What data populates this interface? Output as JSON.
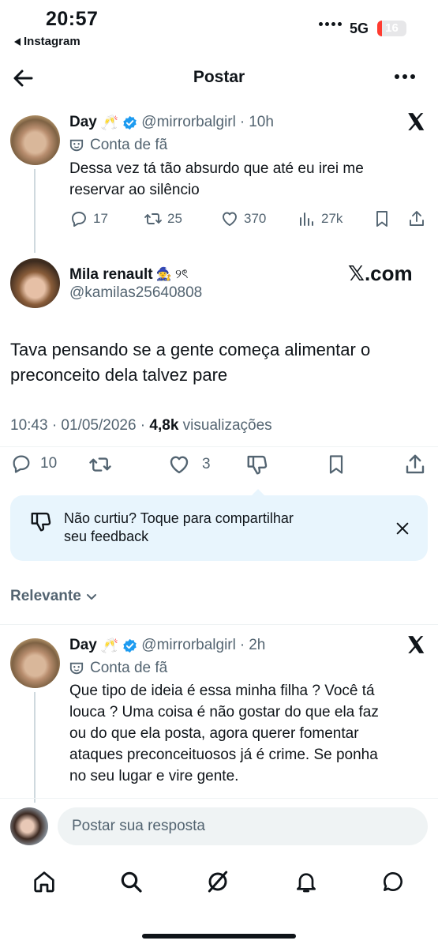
{
  "status_bar": {
    "time": "20:57",
    "back_app": "Instagram",
    "network": "5G",
    "battery": "16"
  },
  "header": {
    "title": "Postar"
  },
  "parent_post": {
    "name": "Day",
    "emoji": "🥂",
    "handle": "@mirrorbalgirl",
    "time": "10h",
    "badge": "Conta de fã",
    "text_lines": [
      "Dessa vez tá tão absurdo que até eu irei me",
      "reservar ao silêncio"
    ],
    "replies": "17",
    "reposts": "25",
    "likes": "370",
    "views": "27k"
  },
  "main_post": {
    "name": "Mila renault",
    "name_emoji": "🧙‍♀️ ୨ৎ",
    "handle": "@kamilas25640808",
    "watermark": "𝕏.com",
    "text_lines": [
      "Tava pensando se a gente começa alimentar o",
      "preconceito dela talvez pare"
    ],
    "timestamp": "10:43 · 01/05/2026 · ",
    "views_count": "4,8k",
    "views_label": " visualizações",
    "replies": "10",
    "likes": "3"
  },
  "feedback_banner": {
    "lines": [
      "Não curtiu? Toque para compartilhar",
      "seu feedback"
    ]
  },
  "sort": {
    "label": "Relevante"
  },
  "reply_post": {
    "name": "Day",
    "emoji": "🥂",
    "handle": "@mirrorbalgirl",
    "time": "2h",
    "badge": "Conta de fã",
    "text_lines": [
      "Que tipo de ideia é essa minha filha ? Você tá",
      "louca ? Uma coisa é não gostar do que ela faz",
      "ou do que ela posta, agora querer fomentar",
      "ataques preconceituosos já é crime. Se ponha",
      "no seu lugar e vire gente."
    ]
  },
  "composer": {
    "placeholder": "Postar sua resposta"
  },
  "icons": {
    "verified": "verified-badge-icon",
    "x": "x-logo-icon",
    "fan": "theater-mask-icon",
    "accent": "#1d9bf0"
  }
}
